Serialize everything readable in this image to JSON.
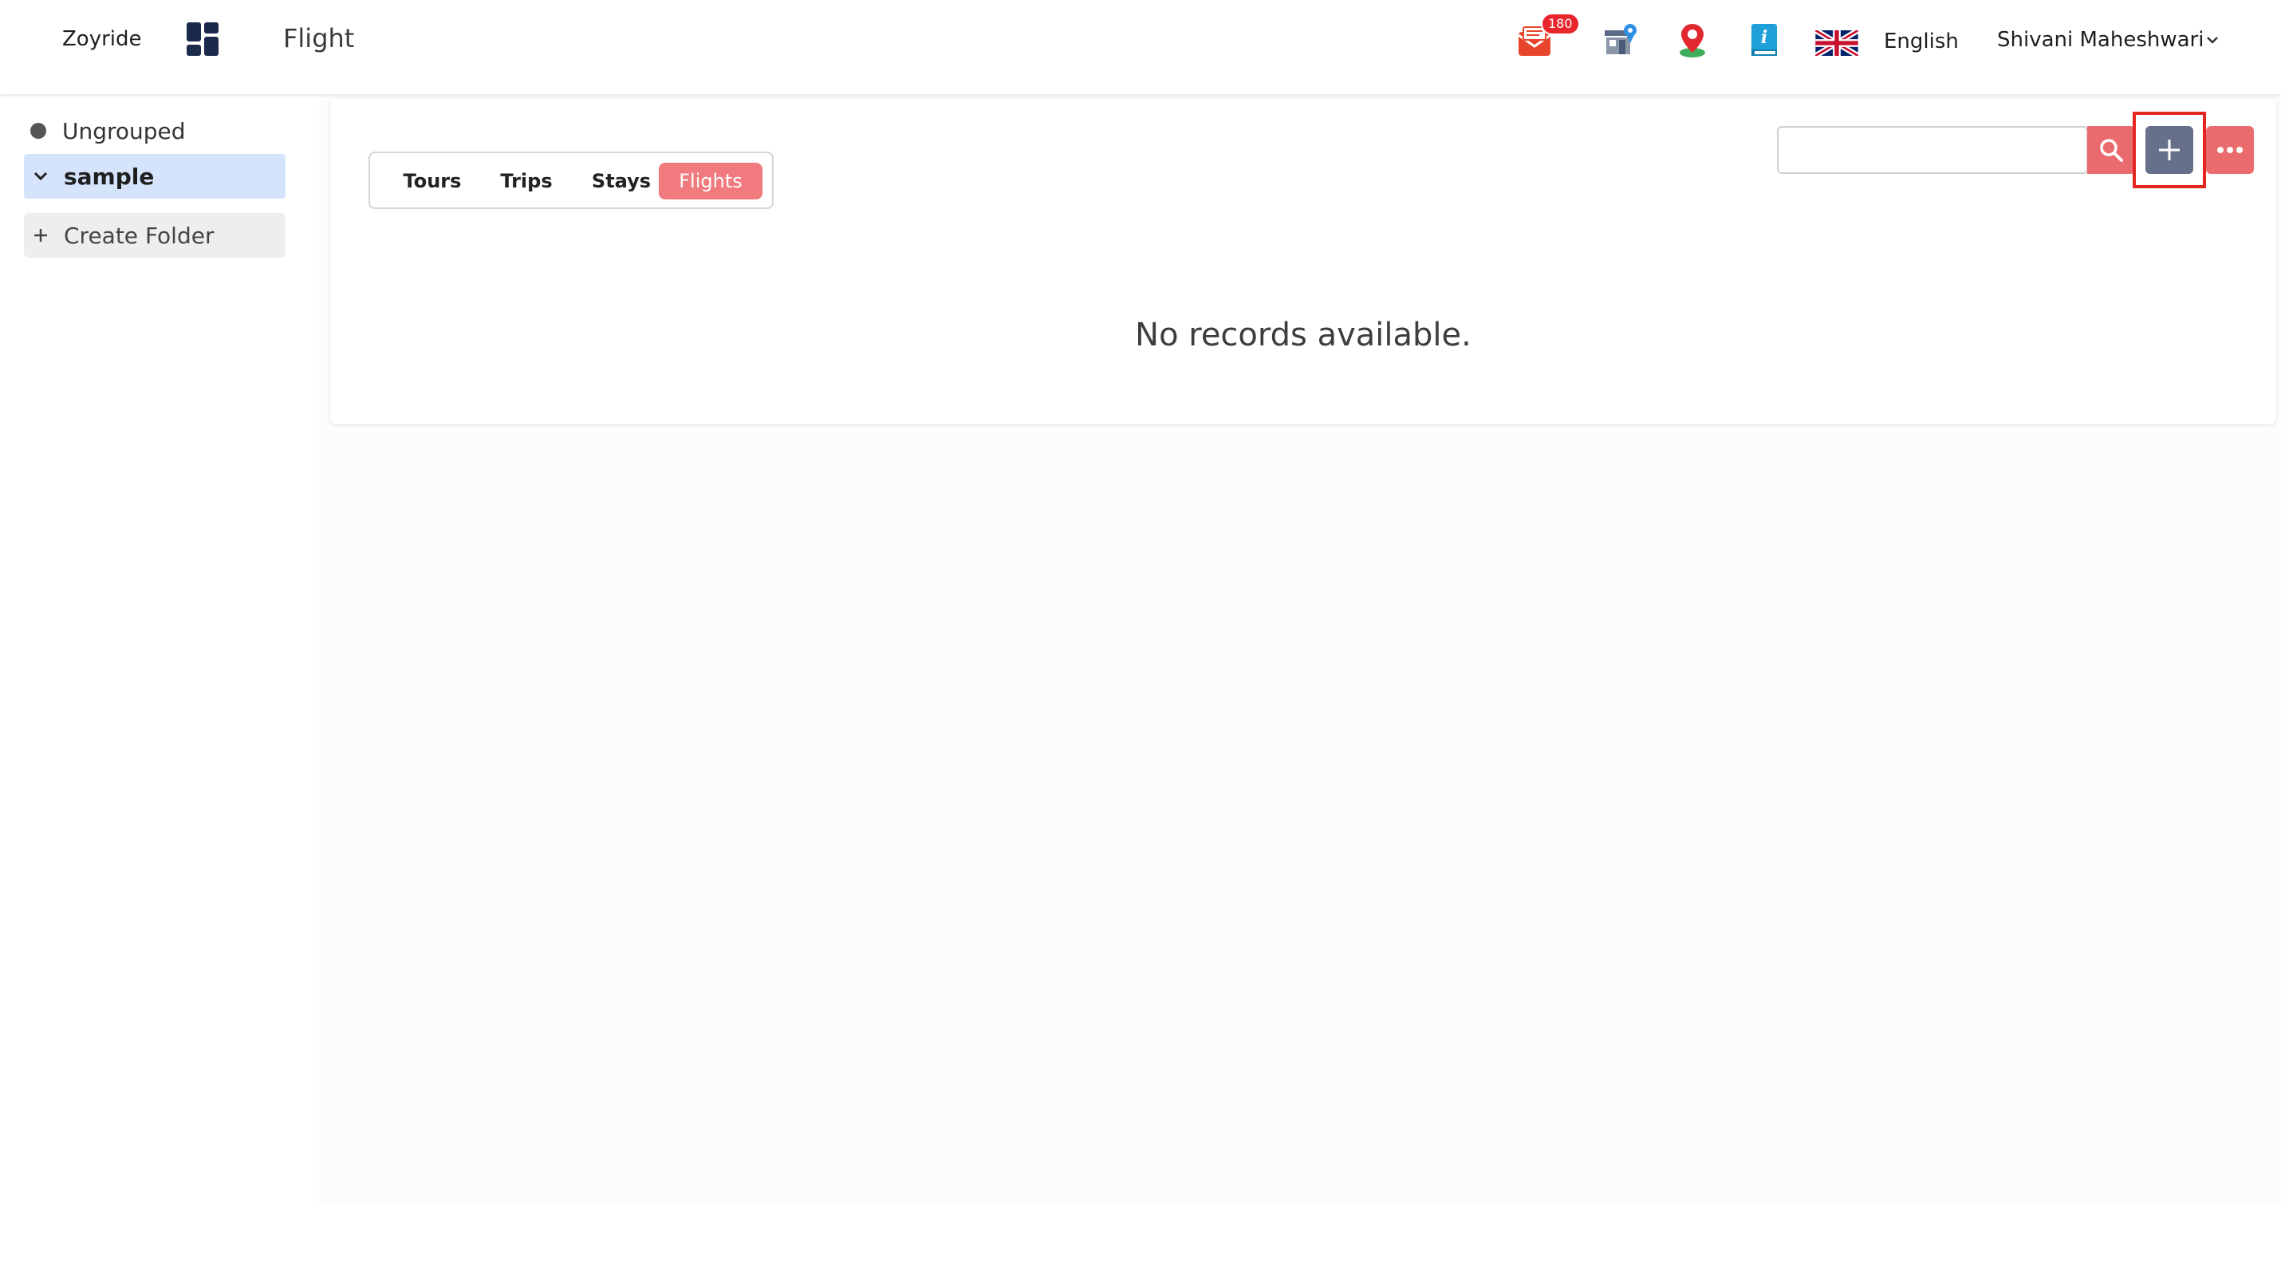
{
  "header": {
    "brand": "Zoyride",
    "apps_icon": "grid-dashboard-icon",
    "title": "Flight",
    "notification_count": "180",
    "icons": [
      "mail-notification-icon",
      "store-location-icon",
      "map-pin-icon",
      "info-book-icon"
    ],
    "language": "English",
    "user_name": "Shivani Maheshwari"
  },
  "sidebar": {
    "items": [
      {
        "label": "Ungrouped",
        "selected": false
      },
      {
        "label": "sample",
        "selected": true
      }
    ],
    "create_folder_label": "Create Folder"
  },
  "main": {
    "tabs": [
      {
        "label": "Tours",
        "active": false
      },
      {
        "label": "Trips",
        "active": false
      },
      {
        "label": "Stays",
        "active": false
      },
      {
        "label": "Flights",
        "active": true
      }
    ],
    "search": {
      "value": "",
      "placeholder": ""
    },
    "empty_message": "No records available."
  },
  "colors": {
    "accent": "#f07a7d",
    "search_button": "#ea6b6e",
    "add_button": "#66708a",
    "highlight": "#e3261f",
    "selected_folder": "#d6e4fb"
  }
}
